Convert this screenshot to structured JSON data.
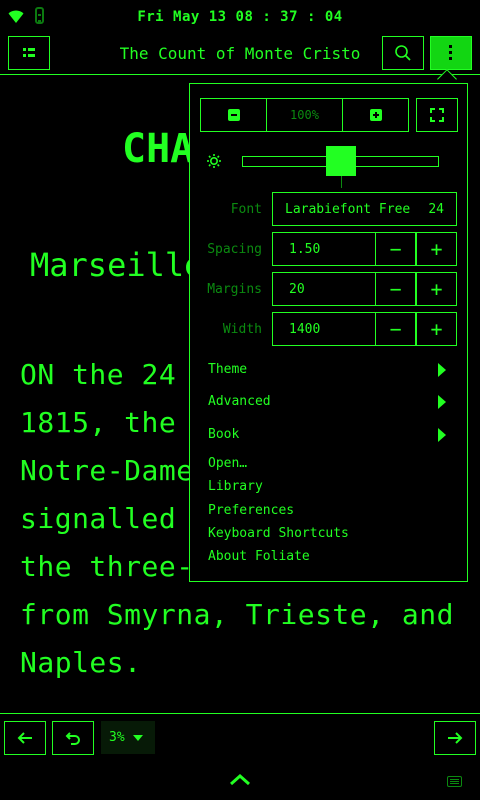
{
  "status": {
    "clock": "Fri May 13 08 : 37 : 04"
  },
  "header": {
    "title": "The Count of Monte Cristo"
  },
  "reader": {
    "chapter_heading": "CHA",
    "chapter_subheading": "Marseille",
    "lines": [
      "ON  the  24",
      "1815,  the",
      "Notre-Dame",
      "signalled",
      "the  three-",
      "from  Smyrna,  Trieste,  and",
      "Naples."
    ]
  },
  "menu": {
    "zoom_level": "100%",
    "brightness_fraction": 0.5,
    "font": {
      "label": "Font",
      "name": "Larabiefont Free",
      "size": "24"
    },
    "spacing": {
      "label": "Spacing",
      "value": "1.50"
    },
    "margins": {
      "label": "Margins",
      "value": "20"
    },
    "width": {
      "label": "Width",
      "value": "1400"
    },
    "stepper": {
      "minus": "−",
      "plus": "+"
    },
    "submenus": [
      "Theme",
      "Advanced",
      "Book"
    ],
    "items": [
      "Open…",
      "Library",
      "Preferences",
      "Keyboard Shortcuts",
      "About Foliate"
    ]
  },
  "bottom": {
    "progress": "3%"
  },
  "colors": {
    "accent": "#22ff22",
    "dim": "#0b8a10",
    "background": "#000000"
  }
}
